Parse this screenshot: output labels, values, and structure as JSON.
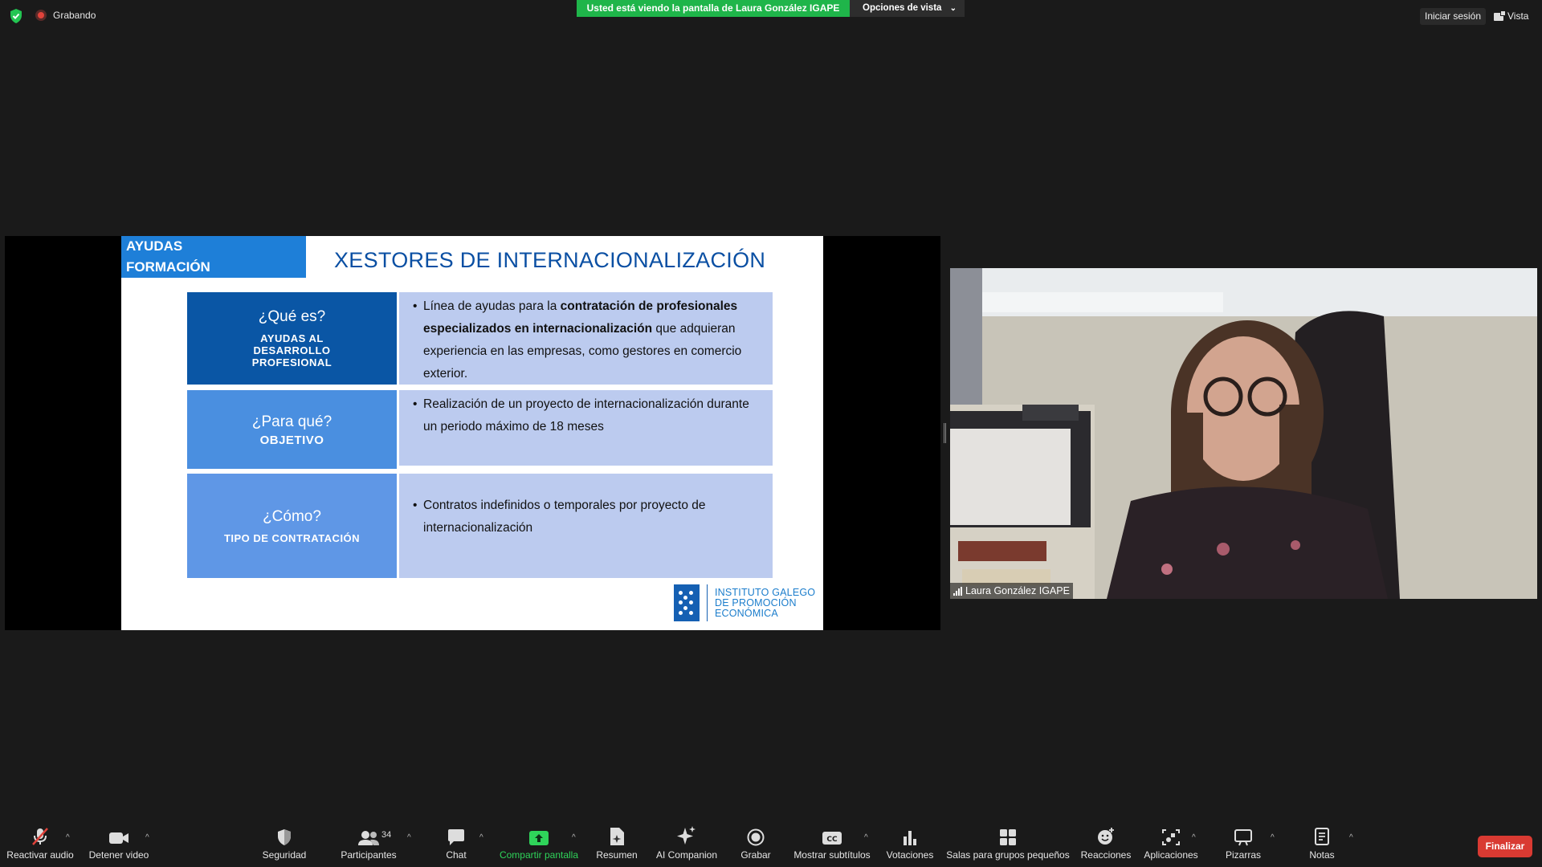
{
  "topbar": {
    "recording_label": "Grabando",
    "banner_text": "Usted está viendo la pantalla de Laura González IGAPE",
    "view_options_label": "Opciones de vista",
    "login_label": "Iniciar sesión",
    "view_label": "Vista"
  },
  "slide": {
    "tag_line1": "AYUDAS",
    "tag_line2": "FORMACIÓN",
    "title": "XESTORES DE INTERNACIONALIZACIÓN",
    "rows": [
      {
        "question": "¿Qué es?",
        "subtitle": "AYUDAS AL DESARROLLO PROFESIONAL",
        "text_before": "Línea de ayudas para la ",
        "text_bold": "contratación de profesionales especializados en internacionalización",
        "text_after": " que adquieran experiencia en las empresas, como gestores en comercio exterior."
      },
      {
        "question": "¿Para qué?",
        "subtitle": "OBJETIVO",
        "text": "Realización de un proyecto de internacionalización durante un periodo máximo de 18 meses"
      },
      {
        "question": "¿Cómo?",
        "subtitle": "TIPO DE CONTRATACIÓN",
        "text": "Contratos indefinidos o temporales por proyecto de internacionalización"
      }
    ],
    "logo_line1": "INSTITUTO GALEGO",
    "logo_line2": "DE PROMOCIÓN",
    "logo_line3": "ECONÓMICA"
  },
  "video": {
    "participant_name": "Laura González IGAPE"
  },
  "toolbar": {
    "unmute_label": "Reactivar audio",
    "stop_video_label": "Detener video",
    "security_label": "Seguridad",
    "participants_label": "Participantes",
    "participants_count": "34",
    "chat_label": "Chat",
    "share_label": "Compartir pantalla",
    "summary_label": "Resumen",
    "companion_label": "AI Companion",
    "record_label": "Grabar",
    "captions_label": "Mostrar subtítulos",
    "polls_label": "Votaciones",
    "breakout_label": "Salas para grupos pequeños",
    "reactions_label": "Reacciones",
    "apps_label": "Aplicaciones",
    "whiteboards_label": "Pizarras",
    "notes_label": "Notas",
    "end_label": "Finalizar"
  },
  "colors": {
    "banner_green": "#1fb54a",
    "end_red": "#d93a32",
    "slide_blue_dark": "#0a56a5",
    "slide_blue_mid": "#4a8fe0",
    "slide_cell_light": "#bccbef"
  }
}
